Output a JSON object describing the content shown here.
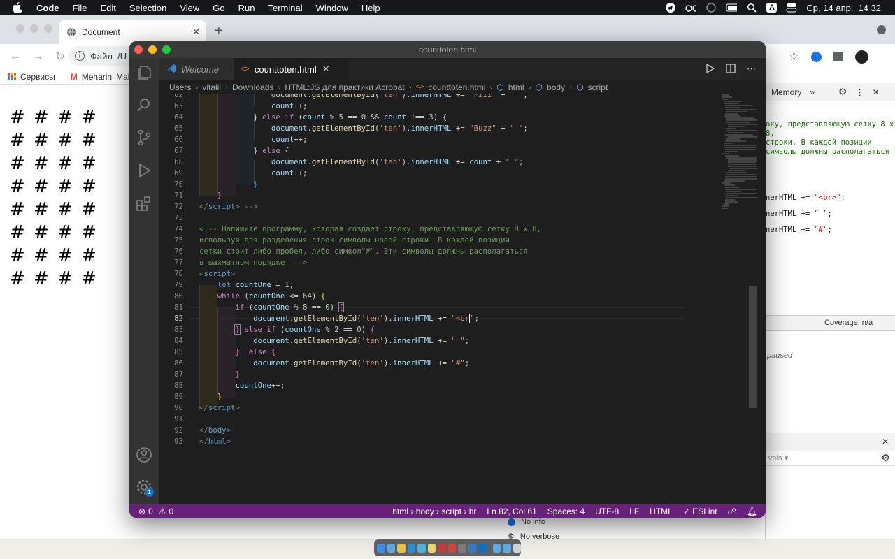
{
  "menubar": {
    "app": "Code",
    "items": [
      "File",
      "Edit",
      "Selection",
      "View",
      "Go",
      "Run",
      "Terminal",
      "Window",
      "Help"
    ],
    "date": "Ср, 14 апр.",
    "time": "14 32",
    "keyboard": "A"
  },
  "browser": {
    "tab_title": "Document",
    "address": "Файл  /U",
    "bookmarks": [
      "Сервисы",
      "Menarini Mail"
    ],
    "hash_rows": [
      "# # # #",
      "# # # #",
      "# # # #",
      "# # # #",
      "# # # #",
      "# # # #",
      "# # # #",
      "# # # #"
    ]
  },
  "devtools": {
    "tab_memory": "Memory",
    "more": "»",
    "coverage": "Coverage: n/a",
    "levels": "vels ▾",
    "no_info": "No info",
    "no_verbose": "No verbose",
    "paused": "paused",
    "comment_lines": [
      "оку, представляющую сетку 8 x 8,",
      "строки. В каждой позиции",
      "символы должны располагаться"
    ],
    "code_lines": [
      [
        "nerHTML += ",
        "\"<br>\"",
        ";"
      ],
      [
        "nerHTML += ",
        "\" \"",
        ";"
      ],
      [
        "nerHTML += ",
        "\"#\"",
        ";"
      ]
    ]
  },
  "vscode": {
    "window_title": "counttoten.html",
    "tabs": [
      {
        "label": "Welcome"
      },
      {
        "label": "counttoten.html"
      }
    ],
    "breadcrumb": [
      "Users",
      "vitalii",
      "Downloads",
      "HTML:JS для практики Acrobat",
      "counttoten.html",
      "html",
      "body",
      "script"
    ],
    "status": {
      "errors": "0",
      "warnings": "0",
      "path": "html › body › script › br",
      "position": "Ln 82, Col 61",
      "spaces": "Spaces: 4",
      "encoding": "UTF-8",
      "eol": "LF",
      "language": "HTML",
      "linter": "ESLint"
    },
    "badge": "1"
  }
}
